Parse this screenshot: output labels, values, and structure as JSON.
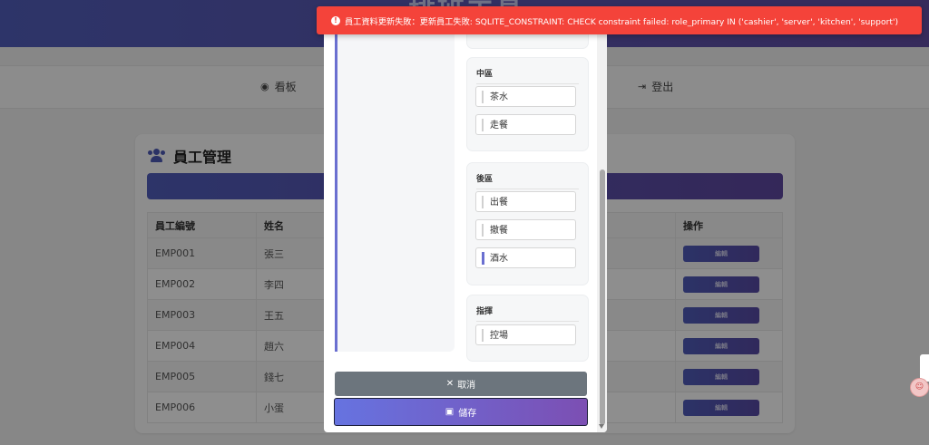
{
  "app": {
    "title": "排班工具"
  },
  "nav": {
    "dashboard": "看板",
    "logout": "登出"
  },
  "card": {
    "title": "員工管理",
    "columns": [
      "員工編號",
      "姓名",
      "操作"
    ],
    "rows": [
      {
        "id": "EMP001",
        "name": "張三",
        "action": "編輯"
      },
      {
        "id": "EMP002",
        "name": "李四",
        "action": "編輯"
      },
      {
        "id": "EMP003",
        "name": "王五",
        "action": "編輯"
      },
      {
        "id": "EMP004",
        "name": "趙六",
        "action": "編輯"
      },
      {
        "id": "EMP005",
        "name": "錢七",
        "action": "編輯"
      },
      {
        "id": "EMP006",
        "name": "小蛋",
        "action": "編輯"
      }
    ]
  },
  "modal": {
    "zones": [
      {
        "title": "中區",
        "roles": [
          "茶水",
          "走餐"
        ]
      },
      {
        "title": "後區",
        "roles": [
          "出餐",
          "撤餐",
          "酒水"
        ]
      },
      {
        "title": "指揮",
        "roles": [
          "控場"
        ]
      }
    ],
    "active_role": "酒水",
    "cancel_label": "取消",
    "save_label": "儲存"
  },
  "toast": {
    "message": "員工資料更新失敗：更新員工失敗: SQLITE_CONSTRAINT: CHECK constraint failed: role_primary IN ('cashier', 'server', 'kitchen', 'support')",
    "color": "#f4433a"
  },
  "colors": {
    "accent": "#4f5bb5",
    "accent2": "#7c4fb3",
    "cancel": "#6c757d"
  }
}
